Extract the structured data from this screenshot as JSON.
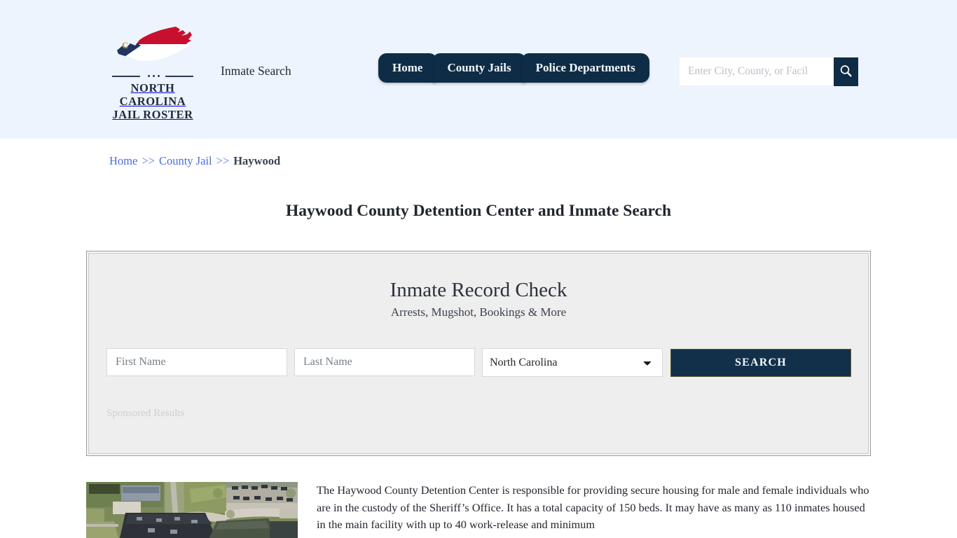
{
  "header": {
    "logo": {
      "icon": "north-carolina-state-map-icon",
      "line1": "NORTH CAROLINA",
      "line2": "JAIL ROSTER",
      "colors": {
        "flag_red": "#c8102e",
        "flag_blue": "#1f3461",
        "flag_white": "#ffffff",
        "star_gold": "#c8a20a"
      }
    },
    "tagline": "Inmate Search",
    "nav": [
      {
        "label": "Home"
      },
      {
        "label": "County Jails"
      },
      {
        "label": "Police Departments"
      }
    ],
    "search": {
      "placeholder": "Enter City, County, or Facil",
      "value": "",
      "button_icon": "search-icon"
    },
    "background_color": "#eef4fd",
    "accent_color": "#0e2c45"
  },
  "breadcrumb": {
    "items": [
      {
        "label": "Home",
        "link": true
      },
      {
        "label": "County Jail",
        "link": true
      },
      {
        "label": "Haywood",
        "link": false
      }
    ],
    "separator": ">>"
  },
  "page": {
    "title": "Haywood County Detention Center and Inmate Search"
  },
  "widget": {
    "title": "Inmate Record Check",
    "subtitle": "Arrests, Mugshot, Bookings & More",
    "form": {
      "first_name_placeholder": "First Name",
      "first_name_value": "",
      "last_name_placeholder": "Last Name",
      "last_name_value": "",
      "state_selected": "North Carolina",
      "state_options": [
        "North Carolina"
      ],
      "search_button": "SEARCH"
    },
    "sponsored_label": "Sponsored Results"
  },
  "content": {
    "image_alt": "aerial-photo-haywood-county-detention-center",
    "paragraph": "The Haywood County Detention Center is responsible for providing secure housing for male and female individuals who are in the custody of the Sheriff’s Office. It has a total capacity of 150 beds. It may have as many as 110 inmates housed in the main facility with up to 40 work-release and minimum"
  }
}
